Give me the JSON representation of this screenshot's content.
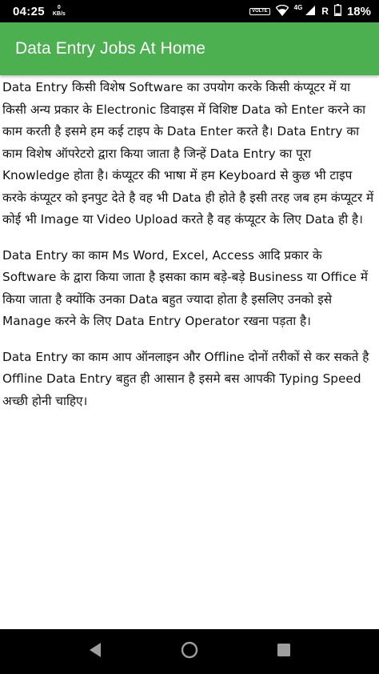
{
  "status_bar": {
    "time": "04:25",
    "speed_value": "0",
    "speed_unit": "KB/s",
    "volte": "VOLTE",
    "network": "4G",
    "roaming": "R",
    "battery": "18%"
  },
  "app_bar": {
    "title": "Data Entry Jobs At Home",
    "color": "#4caf50"
  },
  "content": {
    "paragraphs": [
      "Data Entry किसी विशेष Software का उपयोग करके किसी कंप्यूटर में या किसी अन्य प्रकार के Electronic डिवाइस में विशिष्ट Data को Enter करने का काम करती है इसमे हम कई टाइप के Data Enter करते है। Data Entry का काम विशेष ऑपरेटरो द्वारा किया जाता है जिन्हें Data Entry का पूरा Knowledge होता है। कंप्यूटर की भाषा में हम Keyboard से कुछ भी टाइप करके कंप्यूटर को इनपुट देते है वह भी Data ही होते है इसी तरह जब हम कंप्यूटर में कोई भी Image या Video Upload करते है वह कंप्यूटर के लिए Data ही है।",
      "Data Entry का काम Ms Word, Excel, Access आदि प्रकार के Software के द्वारा किया जाता है इसका काम बड़े-बड़े Business या Office में किया जाता है क्योंकि उनका Data बहुत ज्यादा होता है इसलिए उनको इसे Manage करने के लिए Data Entry Operator रखना पड़ता है।",
      "Data Entry का काम आप ऑनलाइन और Offline दोनों तरीकों से कर सकते है Offline Data Entry बहुत ही आसान है इसमे बस आपकी Typing Speed अच्छी होनी चाहिए।"
    ]
  },
  "nav_bar": {
    "icons": [
      "back-icon",
      "home-icon",
      "recents-icon"
    ]
  }
}
